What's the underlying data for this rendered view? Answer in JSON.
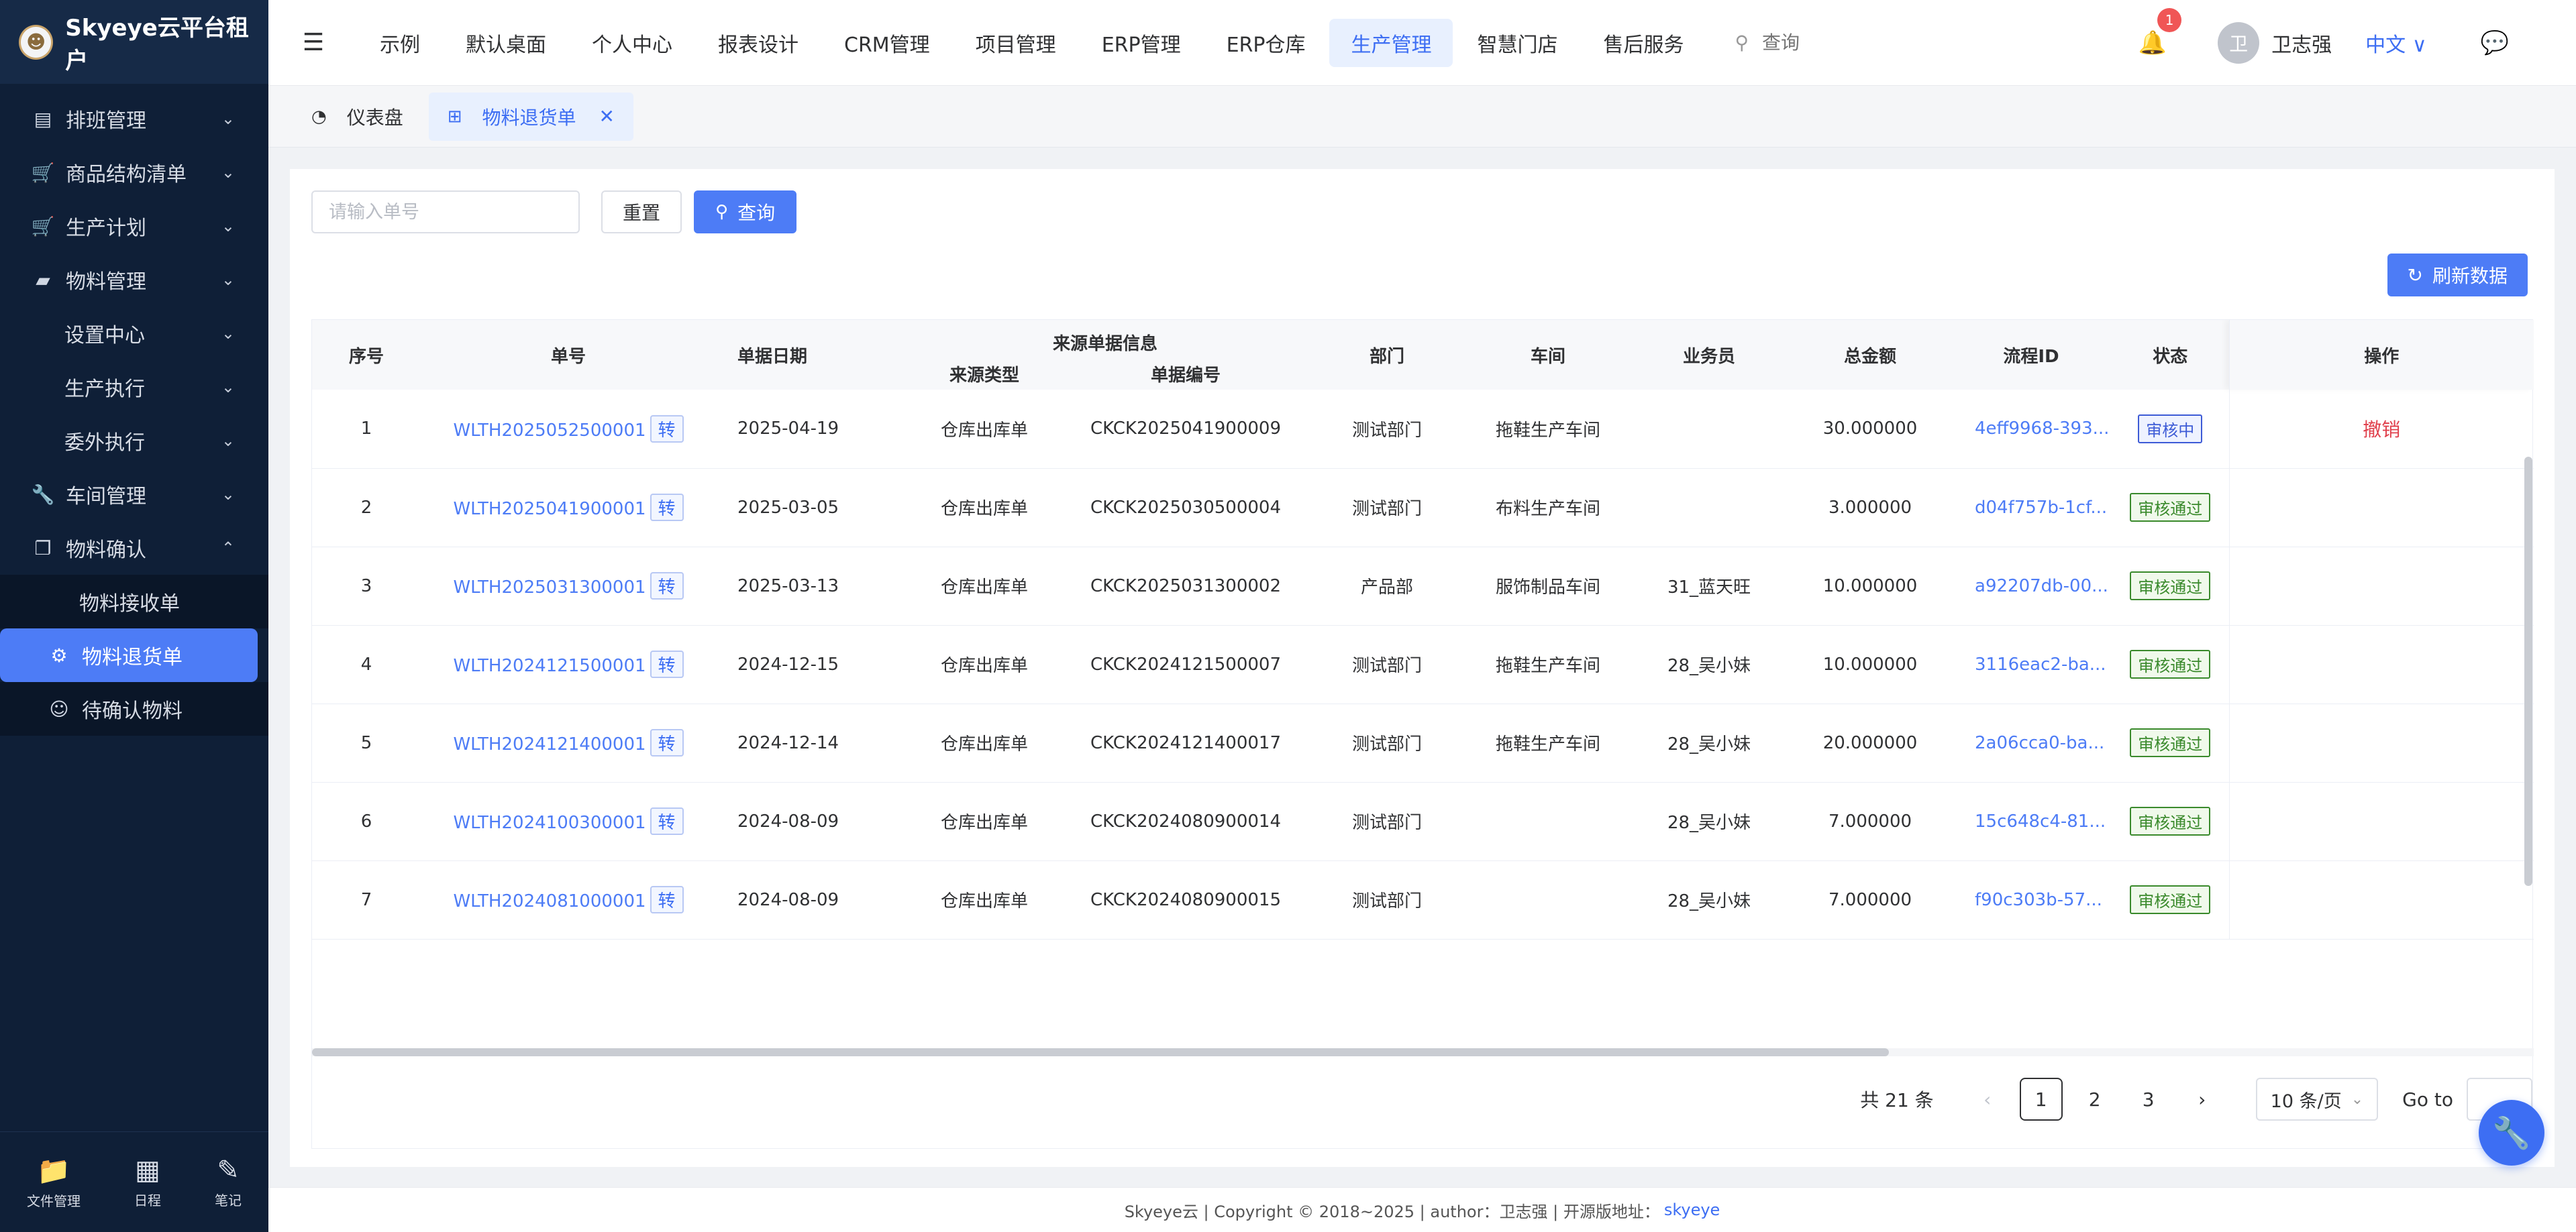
{
  "brand": {
    "title": "Skyeye云平台租户"
  },
  "sidebar": {
    "items": [
      {
        "label": "排班管理",
        "icon": "▤",
        "icon_name": "schedule-icon",
        "arrow": "⌄"
      },
      {
        "label": "商品结构清单",
        "icon": "🛒",
        "icon_name": "cart-icon",
        "arrow": "⌄"
      },
      {
        "label": "生产计划",
        "icon": "🛒",
        "icon_name": "cart-icon",
        "arrow": "⌄"
      },
      {
        "label": "物料管理",
        "icon": "▰",
        "icon_name": "folder-icon",
        "arrow": "⌄"
      },
      {
        "label": "设置中心",
        "arrow": "⌄"
      },
      {
        "label": "生产执行",
        "arrow": "⌄"
      },
      {
        "label": "委外执行",
        "arrow": "⌄"
      },
      {
        "label": "车间管理",
        "icon": "🔧",
        "icon_name": "wrench-icon",
        "arrow": "⌄"
      },
      {
        "label": "物料确认",
        "icon": "❐",
        "icon_name": "copy-icon",
        "arrow": "⌃"
      },
      {
        "label": "物料接收单"
      },
      {
        "label": "物料退货单",
        "icon": "⚙",
        "icon_name": "gear-icon"
      },
      {
        "label": "待确认物料",
        "icon": "☺",
        "icon_name": "smile-icon"
      }
    ],
    "bottom": [
      {
        "label": "文件管理",
        "icon": "📁",
        "icon_name": "folder-icon"
      },
      {
        "label": "日程",
        "icon": "▦",
        "icon_name": "calendar-icon"
      },
      {
        "label": "笔记",
        "icon": "✎",
        "icon_name": "edit-icon"
      }
    ]
  },
  "header": {
    "nav": [
      "示例",
      "默认桌面",
      "个人中心",
      "报表设计",
      "CRM管理",
      "项目管理",
      "ERP管理",
      "ERP仓库",
      "生产管理",
      "智慧门店",
      "售后服务"
    ],
    "active_nav": "生产管理",
    "search_placeholder": "查询",
    "notification_count": "1",
    "avatar_text": "卫",
    "username": "卫志强",
    "language": "中文 ∨"
  },
  "tabs": [
    {
      "label": "仪表盘",
      "icon": "◔",
      "icon_name": "dashboard-icon"
    },
    {
      "label": "物料退货单",
      "icon": "⊞",
      "icon_name": "grid-icon",
      "close": "✕"
    }
  ],
  "filters": {
    "order_placeholder": "请输入单号",
    "reset_label": "重置",
    "search_label": "查询",
    "refresh_label": "刷新数据"
  },
  "table": {
    "headers": {
      "index": "序号",
      "order_no": "单号",
      "date": "单据日期",
      "source_group": "来源单据信息",
      "source_type": "来源类型",
      "source_no": "单据编号",
      "department": "部门",
      "workshop": "车间",
      "salesman": "业务员",
      "amount": "总金额",
      "flow_id": "流程ID",
      "status": "状态",
      "actions": "操作"
    },
    "convert_label": "转",
    "rows": [
      {
        "index": "1",
        "order_no": "WLTH2025052500001",
        "date": "2025-04-19",
        "source_type": "仓库出库单",
        "source_no": "CKCK2025041900009",
        "department": "测试部门",
        "workshop": "拖鞋生产车间",
        "salesman": "",
        "amount": "30.000000",
        "flow_id": "4eff9968-393...",
        "status": "审核中",
        "status_kind": "pending",
        "action": "撤销"
      },
      {
        "index": "2",
        "order_no": "WLTH2025041900001",
        "date": "2025-03-05",
        "source_type": "仓库出库单",
        "source_no": "CKCK2025030500004",
        "department": "测试部门",
        "workshop": "布料生产车间",
        "salesman": "",
        "amount": "3.000000",
        "flow_id": "d04f757b-1cf...",
        "status": "审核通过",
        "status_kind": "pass",
        "action": ""
      },
      {
        "index": "3",
        "order_no": "WLTH2025031300001",
        "date": "2025-03-13",
        "source_type": "仓库出库单",
        "source_no": "CKCK2025031300002",
        "department": "产品部",
        "workshop": "服饰制品车间",
        "salesman": "31_蓝天旺",
        "amount": "10.000000",
        "flow_id": "a92207db-00...",
        "status": "审核通过",
        "status_kind": "pass",
        "action": ""
      },
      {
        "index": "4",
        "order_no": "WLTH2024121500001",
        "date": "2024-12-15",
        "source_type": "仓库出库单",
        "source_no": "CKCK2024121500007",
        "department": "测试部门",
        "workshop": "拖鞋生产车间",
        "salesman": "28_吴小妹",
        "amount": "10.000000",
        "flow_id": "3116eac2-ba...",
        "status": "审核通过",
        "status_kind": "pass",
        "action": ""
      },
      {
        "index": "5",
        "order_no": "WLTH2024121400001",
        "date": "2024-12-14",
        "source_type": "仓库出库单",
        "source_no": "CKCK2024121400017",
        "department": "测试部门",
        "workshop": "拖鞋生产车间",
        "salesman": "28_吴小妹",
        "amount": "20.000000",
        "flow_id": "2a06cca0-ba...",
        "status": "审核通过",
        "status_kind": "pass",
        "action": ""
      },
      {
        "index": "6",
        "order_no": "WLTH2024100300001",
        "date": "2024-08-09",
        "source_type": "仓库出库单",
        "source_no": "CKCK2024080900014",
        "department": "测试部门",
        "workshop": "",
        "salesman": "28_吴小妹",
        "amount": "7.000000",
        "flow_id": "15c648c4-81...",
        "status": "审核通过",
        "status_kind": "pass",
        "action": ""
      },
      {
        "index": "7",
        "order_no": "WLTH2024081000001",
        "date": "2024-08-09",
        "source_type": "仓库出库单",
        "source_no": "CKCK2024080900015",
        "department": "测试部门",
        "workshop": "",
        "salesman": "28_吴小妹",
        "amount": "7.000000",
        "flow_id": "f90c303b-57...",
        "status": "审核通过",
        "status_kind": "pass",
        "action": ""
      }
    ]
  },
  "pagination": {
    "total": "共 21 条",
    "pages": [
      "1",
      "2",
      "3"
    ],
    "current": "1",
    "page_size": "10 条/页",
    "goto_label": "Go to"
  },
  "footer": {
    "text": "Skyeye云 | Copyright © 2018~2025 | author：卫志强 | 开源版地址：",
    "link": "skyeye"
  },
  "colors": {
    "accent": "#4d7cf6",
    "sidebar": "#0f1f37",
    "danger": "#e0404c",
    "pass": "#3a8a2c"
  }
}
